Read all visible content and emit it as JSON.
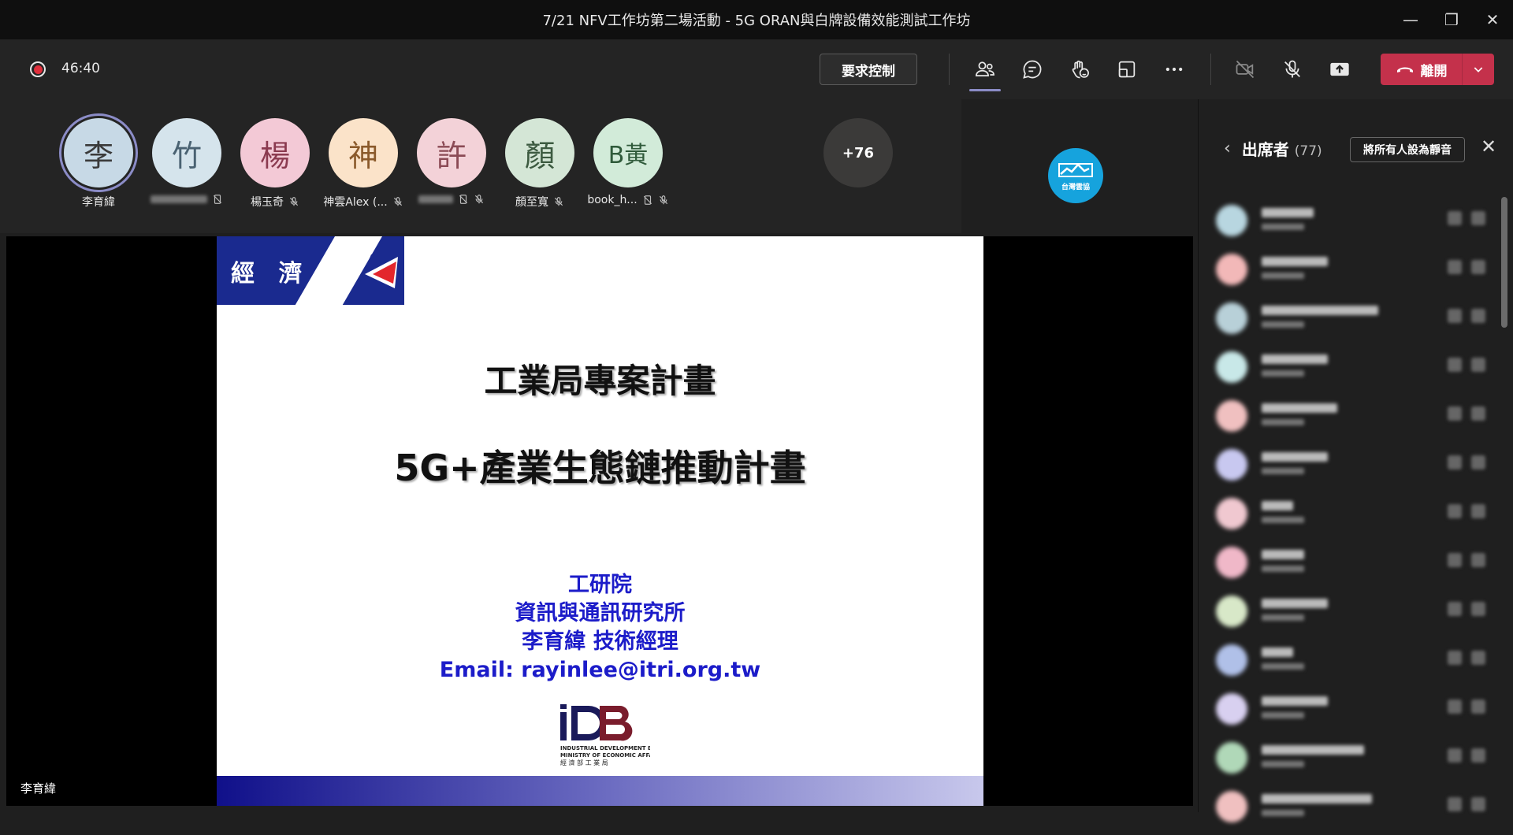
{
  "window": {
    "title": "7/21 NFV工作坊第二場活動 - 5G ORAN與白牌設備效能測試工作坊",
    "minimize_glyph": "—",
    "restore_glyph": "❐",
    "close_glyph": "✕"
  },
  "toolbar": {
    "timer": "46:40",
    "request_control_label": "要求控制",
    "leave_label": "離開",
    "icons": [
      "participants-icon",
      "chat-icon",
      "reactions-icon",
      "share-tray-icon",
      "more-icon",
      "camera-off-icon",
      "mic-off-icon",
      "share-screen-icon"
    ]
  },
  "gallery": {
    "tiles": [
      {
        "initial": "李",
        "name": "李育緯",
        "bg": "#c7d9e6",
        "fg": "#3a3a3a",
        "active": true
      },
      {
        "initial": "竹",
        "name": "",
        "bg": "#d5e4ec",
        "fg": "#4a6272"
      },
      {
        "initial": "楊",
        "name": "楊玉奇",
        "bg": "#f3c9d6",
        "fg": "#8b3a50"
      },
      {
        "initial": "神",
        "name": "神雲Alex (...",
        "bg": "#fbe3c9",
        "fg": "#8b5a2b"
      },
      {
        "initial": "許",
        "name": "",
        "bg": "#f3d2d8",
        "fg": "#8b4a55"
      },
      {
        "initial": "顏",
        "name": "顏至寬",
        "bg": "#d4e6d6",
        "fg": "#3c5a40"
      },
      {
        "initial": "B黃",
        "name": "book_h...",
        "bg": "#d2ebd9",
        "fg": "#2f5a3a"
      }
    ],
    "overflow": "+76",
    "logo_text": "台灣雲協"
  },
  "slide": {
    "ministry": "經 濟 部",
    "title1": "工業局專案計畫",
    "title2": "5G+產業生態鏈推動計畫",
    "info": [
      "工研院",
      "資訊與通訊研究所",
      "李育緯 技術經理",
      "Email: rayinlee@itri.org.tw"
    ],
    "idb_lines": [
      "INDUSTRIAL DEVELOPMENT BUREAU,",
      "MINISTRY OF ECONOMIC AFFAIRS",
      "經 濟 部 工 業 局"
    ],
    "presenter": "李育緯"
  },
  "panel": {
    "title": "出席者",
    "count": "(77)",
    "mute_all_label": "將所有人設為靜音",
    "rows": [
      {
        "bg": "#b8d6e0",
        "w": 66
      },
      {
        "bg": "#f2b8b8",
        "w": 84
      },
      {
        "bg": "#b8d0d8",
        "w": 148
      },
      {
        "bg": "#c8e8e8",
        "w": 84
      },
      {
        "bg": "#f0c0c0",
        "w": 96
      },
      {
        "bg": "#c8c8f0",
        "w": 84
      },
      {
        "bg": "#f0c8d0",
        "w": 40
      },
      {
        "bg": "#f0b8c8",
        "w": 54
      },
      {
        "bg": "#d8e8c8",
        "w": 84
      },
      {
        "bg": "#b0c0e8",
        "w": 40
      },
      {
        "bg": "#d8d0f0",
        "w": 84
      },
      {
        "bg": "#b0d8b8",
        "w": 130
      },
      {
        "bg": "#f0c0c0",
        "w": 140
      }
    ]
  }
}
